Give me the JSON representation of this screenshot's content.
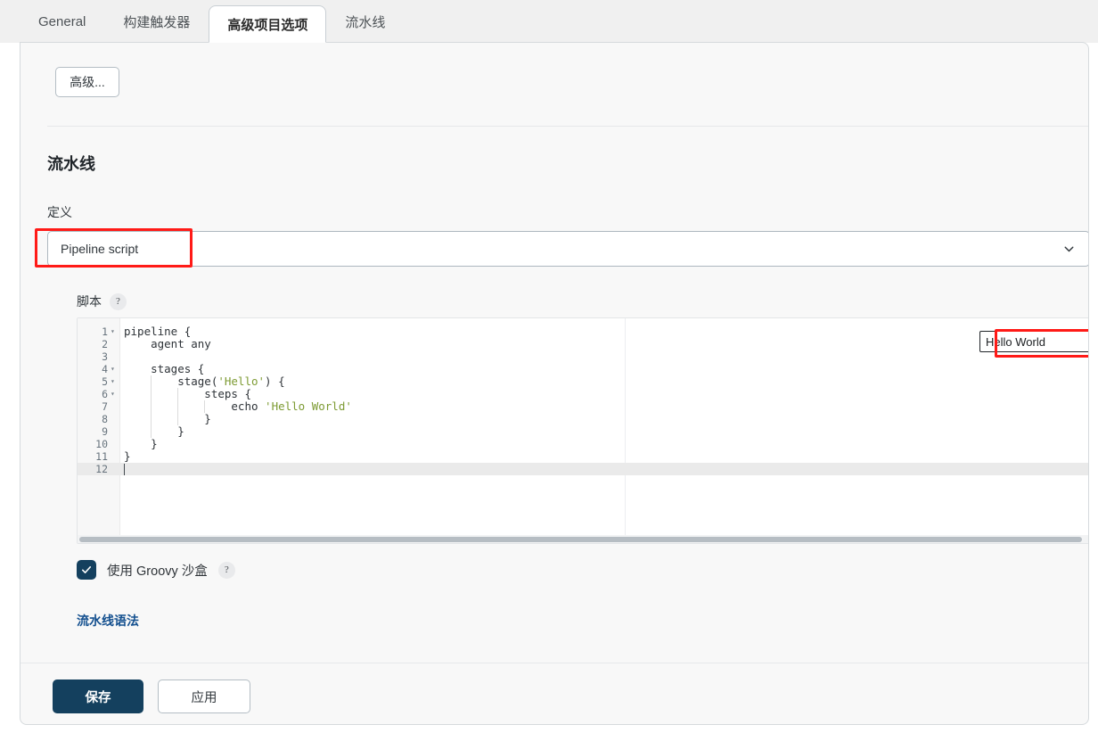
{
  "tabs": [
    {
      "label": "General",
      "active": false
    },
    {
      "label": "构建触发器",
      "active": false
    },
    {
      "label": "高级项目选项",
      "active": true
    },
    {
      "label": "流水线",
      "active": false
    }
  ],
  "advanced_button": {
    "label": "高级..."
  },
  "pipeline_section": {
    "title": "流水线",
    "definition_label": "定义",
    "definition_value": "Pipeline script",
    "definition_chevron": "chevron-down"
  },
  "script": {
    "label": "脚本",
    "help": "?",
    "sample_select_value": "Hello World",
    "sample_select_chevron": "chevron-down",
    "lines": [
      {
        "num": "1",
        "fold": "▾",
        "indent": 0,
        "text": "pipeline {"
      },
      {
        "num": "2",
        "fold": "",
        "indent": 0,
        "text": "    agent any"
      },
      {
        "num": "3",
        "fold": "",
        "indent": 0,
        "text": ""
      },
      {
        "num": "4",
        "fold": "▾",
        "indent": 0,
        "text": "    stages {"
      },
      {
        "num": "5",
        "fold": "▾",
        "indent": 1,
        "text": "        stage('Hello') {",
        "str": "'Hello'"
      },
      {
        "num": "6",
        "fold": "▾",
        "indent": 2,
        "text": "            steps {"
      },
      {
        "num": "7",
        "fold": "",
        "indent": 3,
        "text": "                echo 'Hello World'",
        "str": "'Hello World'"
      },
      {
        "num": "8",
        "fold": "",
        "indent": 2,
        "text": "            }"
      },
      {
        "num": "9",
        "fold": "",
        "indent": 1,
        "text": "        }"
      },
      {
        "num": "10",
        "fold": "",
        "indent": 0,
        "text": "    }"
      },
      {
        "num": "11",
        "fold": "",
        "indent": 0,
        "text": "}"
      },
      {
        "num": "12",
        "fold": "",
        "indent": 0,
        "text": "",
        "active": true
      }
    ]
  },
  "sandbox": {
    "checked": true,
    "label": "使用 Groovy 沙盒",
    "help": "?"
  },
  "syntax_link": {
    "label": "流水线语法"
  },
  "footer": {
    "save_label": "保存",
    "apply_label": "应用"
  },
  "colors": {
    "accent": "#14405e",
    "link": "#14508f",
    "annotation": "#ff1a17",
    "string_token": "#7d9b33",
    "panel_bg": "#f8f8f8",
    "tabbar_bg": "#f0f0f0"
  }
}
